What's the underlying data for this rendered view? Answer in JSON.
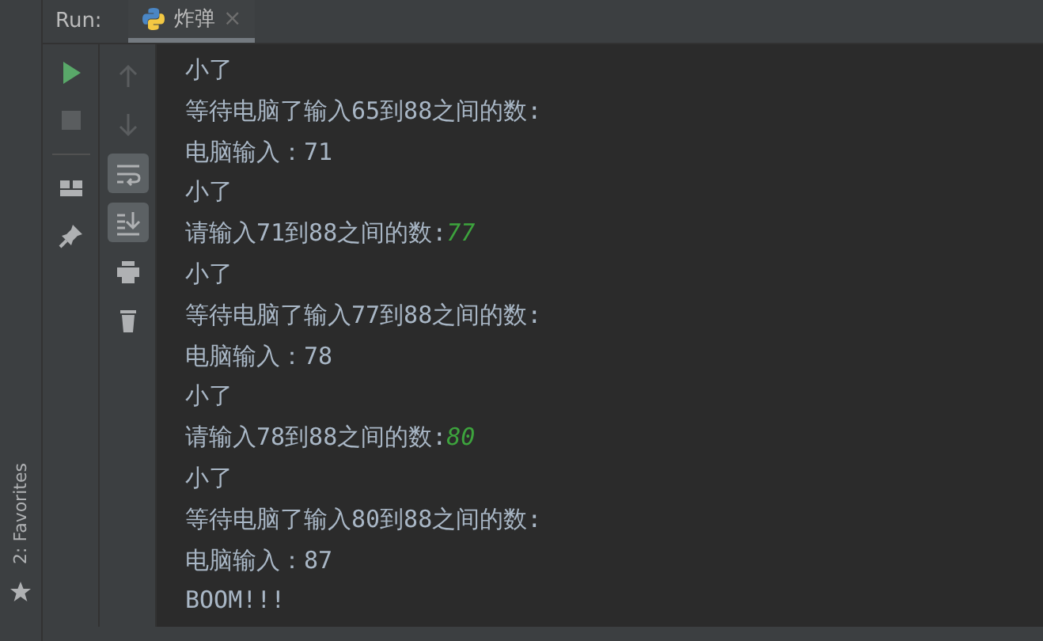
{
  "run_panel": {
    "label": "Run:",
    "tab": {
      "title": "炸弹",
      "selected": true,
      "close": "×"
    }
  },
  "left_toolbar": [
    {
      "kind": "rerun",
      "disabled": false
    },
    {
      "kind": "stop",
      "disabled": true
    },
    {
      "kind": "layout",
      "disabled": false
    },
    {
      "kind": "pin",
      "disabled": false
    }
  ],
  "right_toolbar": [
    {
      "kind": "up",
      "disabled": true,
      "selected": false
    },
    {
      "kind": "down",
      "disabled": true,
      "selected": false
    },
    {
      "kind": "wrap",
      "disabled": false,
      "selected": true
    },
    {
      "kind": "scroll-end",
      "disabled": false,
      "selected": true
    },
    {
      "kind": "print",
      "disabled": false,
      "selected": false
    },
    {
      "kind": "trash",
      "disabled": false,
      "selected": false
    }
  ],
  "favorites": {
    "label": "2: Favorites"
  },
  "console": [
    {
      "text": "小了"
    },
    {
      "text": "等待电脑了输入65到88之间的数:"
    },
    {
      "text": "电脑输入：71"
    },
    {
      "text": "小了"
    },
    {
      "text": "请输入71到88之间的数:",
      "input": "77"
    },
    {
      "text": "小了"
    },
    {
      "text": "等待电脑了输入77到88之间的数:"
    },
    {
      "text": "电脑输入：78"
    },
    {
      "text": "小了"
    },
    {
      "text": "请输入78到88之间的数:",
      "input": "80"
    },
    {
      "text": "小了"
    },
    {
      "text": "等待电脑了输入80到88之间的数:"
    },
    {
      "text": "电脑输入：87"
    },
    {
      "text": "BOOM!!!"
    }
  ]
}
